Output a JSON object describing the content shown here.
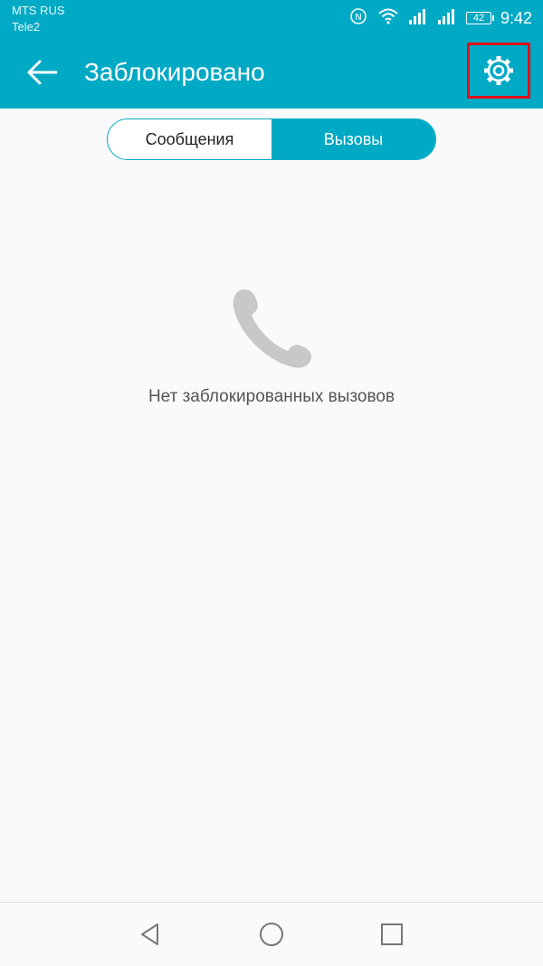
{
  "status_bar": {
    "carrier_1": "MTS RUS",
    "carrier_2": "Tele2",
    "battery_level": "42",
    "time": "9:42"
  },
  "header": {
    "title": "Заблокировано",
    "back_icon": "arrow-left-icon",
    "settings_icon": "gear-icon"
  },
  "tabs": [
    {
      "label": "Сообщения",
      "selected": false
    },
    {
      "label": "Вызовы",
      "selected": true
    }
  ],
  "empty_state": {
    "icon": "phone-icon",
    "text": "Нет заблокированных вызовов"
  },
  "colors": {
    "accent": "#00a9c4",
    "highlight": "#e0111b"
  }
}
